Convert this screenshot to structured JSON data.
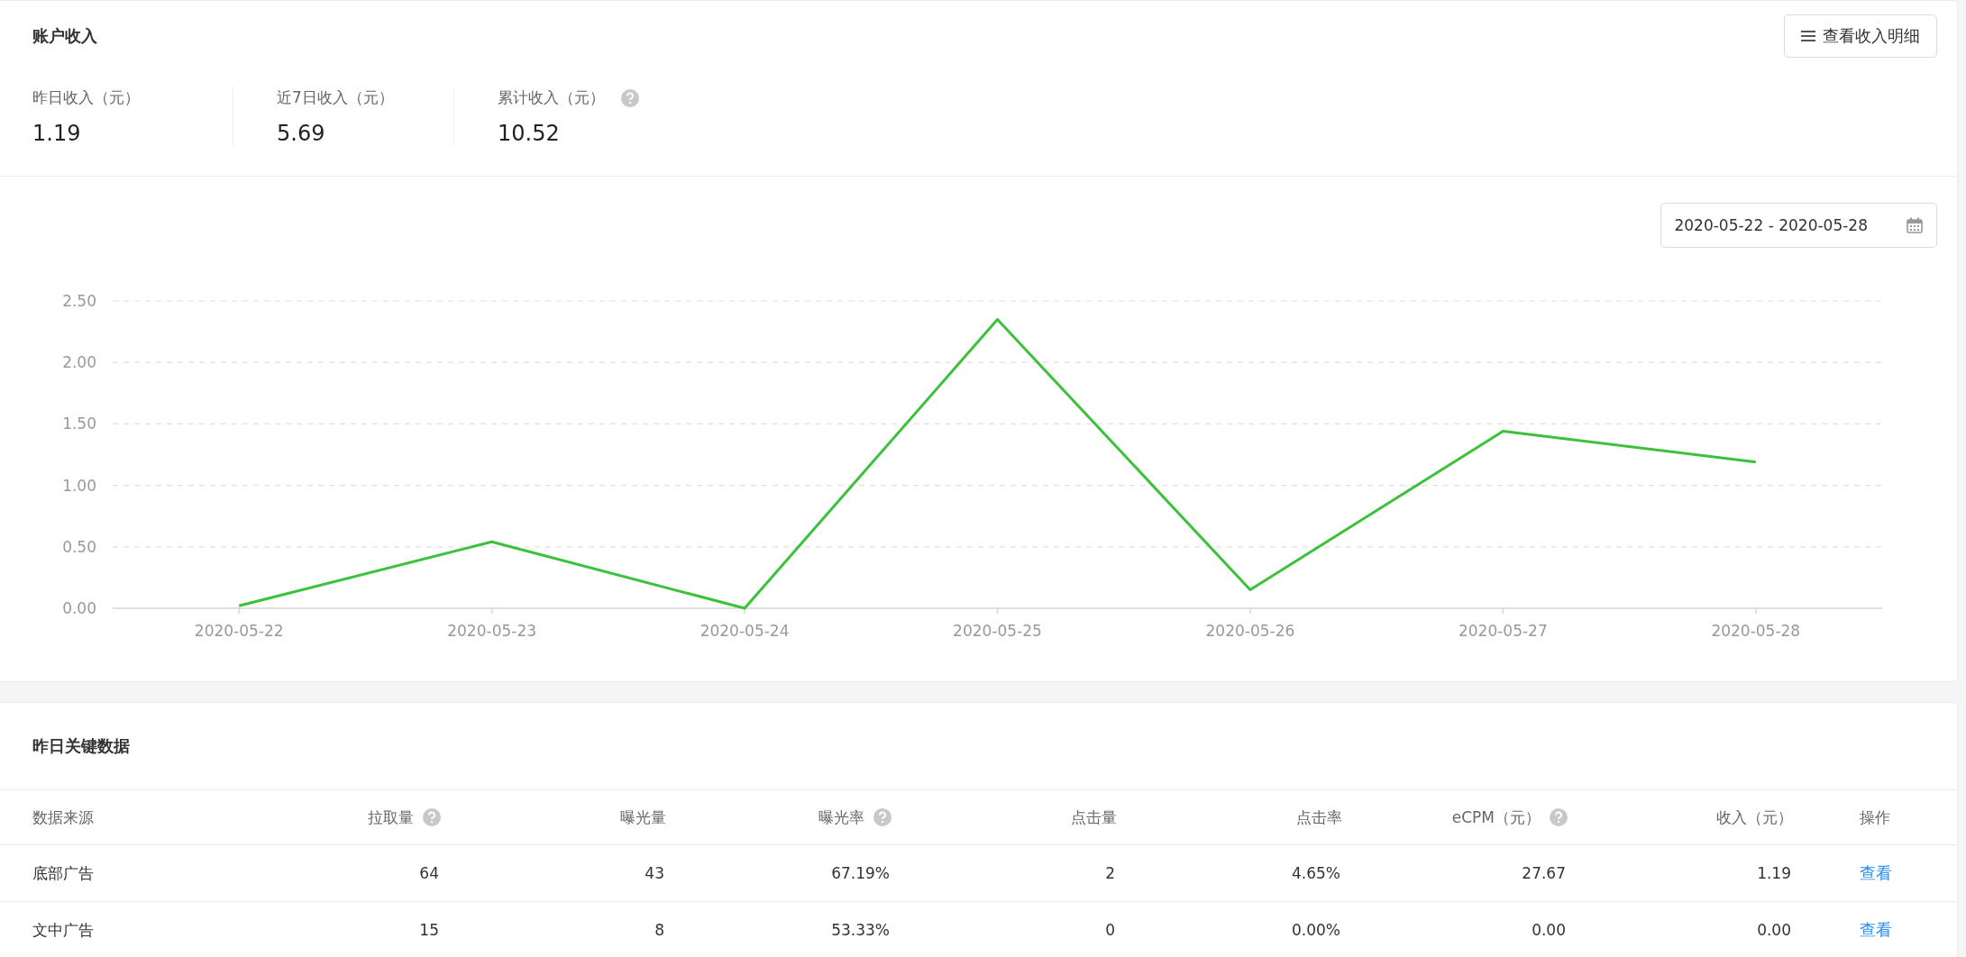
{
  "income": {
    "title": "账户收入",
    "detail_button": "查看收入明细",
    "stats": [
      {
        "label": "昨日收入（元）",
        "value": "1.19",
        "kind": "plain"
      },
      {
        "label": "近7日收入（元）",
        "value": "5.69",
        "kind": "plain"
      },
      {
        "label": "累计收入（元）",
        "value": "10.52",
        "kind": "help"
      }
    ],
    "date_range": "2020-05-22 - 2020-05-28",
    "chart_data": {
      "type": "line",
      "categories": [
        "2020-05-22",
        "2020-05-23",
        "2020-05-24",
        "2020-05-25",
        "2020-05-26",
        "2020-05-27",
        "2020-05-28"
      ],
      "series": [
        {
          "color": "#3cc13b",
          "values": [
            0.02,
            0.54,
            0.0,
            2.35,
            0.15,
            1.44,
            1.19
          ]
        }
      ],
      "ylim": [
        0,
        2.5
      ],
      "grid": true,
      "yticks": [
        {
          "value": 0,
          "label": "0.00"
        },
        {
          "value": 0.5,
          "label": "0.50"
        },
        {
          "value": 1,
          "label": "1.00"
        },
        {
          "value": 1.5,
          "label": "1.50"
        },
        {
          "value": 2,
          "label": "2.00"
        },
        {
          "value": 2.5,
          "label": "2.50"
        }
      ]
    }
  },
  "key_data": {
    "title": "昨日关键数据",
    "columns": [
      {
        "label": "数据来源",
        "kind": "plain"
      },
      {
        "label": "拉取量",
        "kind": "help"
      },
      {
        "label": "曝光量",
        "kind": "plain"
      },
      {
        "label": "曝光率",
        "kind": "help"
      },
      {
        "label": "点击量",
        "kind": "plain"
      },
      {
        "label": "点击率",
        "kind": "plain"
      },
      {
        "label": "eCPM（元）",
        "kind": "help"
      },
      {
        "label": "收入（元）",
        "kind": "plain"
      },
      {
        "label": "操作",
        "kind": "plain"
      }
    ],
    "rows": [
      {
        "cells": [
          "底部广告",
          "64",
          "43",
          "67.19%",
          "2",
          "4.65%",
          "27.67",
          "1.19"
        ],
        "action": "查看"
      },
      {
        "cells": [
          "文中广告",
          "15",
          "8",
          "53.33%",
          "0",
          "0.00%",
          "0.00",
          "0.00"
        ],
        "action": "查看"
      }
    ]
  }
}
